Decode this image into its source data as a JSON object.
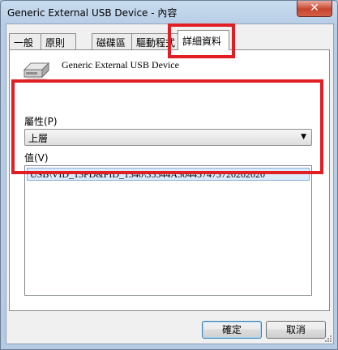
{
  "window": {
    "title": "Generic External USB Device - 內容",
    "close_label": "✕"
  },
  "tabs": [
    {
      "label": "一般",
      "active": false
    },
    {
      "label": "原則",
      "active": false
    },
    {
      "label": "磁碟區",
      "active": false
    },
    {
      "label": "驅動程式",
      "active": false
    },
    {
      "label": "詳細資料",
      "active": true
    }
  ],
  "device": {
    "name": "Generic External USB Device",
    "icon": "usb-drive-icon"
  },
  "property": {
    "label": "屬性(P)",
    "selected": "上層",
    "arrow": "▼"
  },
  "value": {
    "label": "值(V)",
    "items": [
      "USB\\VID_13FD&PID_1340\\35544A304457473720202020"
    ]
  },
  "buttons": {
    "ok": "確定",
    "cancel": "取消"
  },
  "colors": {
    "highlight": "#e01e24",
    "selection": "#dcebfc",
    "titlebar": "#b9d1ea"
  }
}
